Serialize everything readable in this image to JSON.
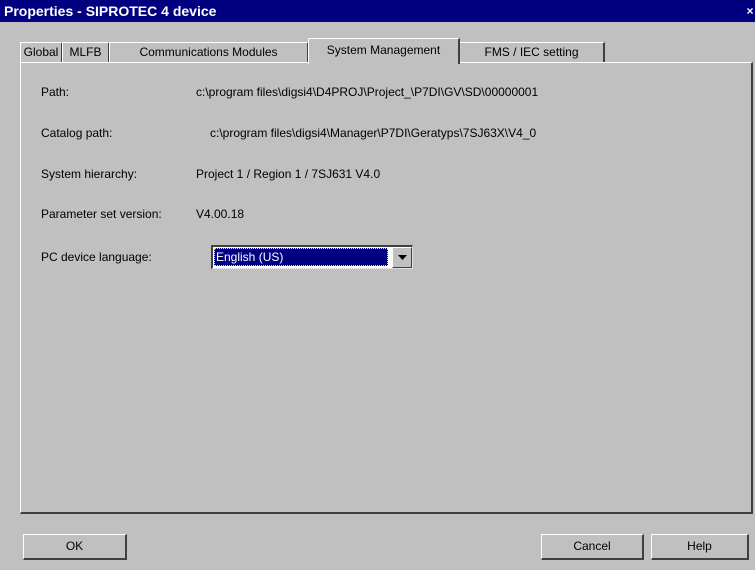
{
  "window": {
    "title": "Properties - SIPROTEC 4 device",
    "close_glyph": "×"
  },
  "tabs": [
    {
      "label": "Global"
    },
    {
      "label": "MLFB"
    },
    {
      "label": "Communications Modules"
    },
    {
      "label": "System Management",
      "active": true
    },
    {
      "label": "FMS / IEC setting"
    }
  ],
  "fields": {
    "path": {
      "label": "Path:",
      "value": "c:\\program files\\digsi4\\D4PROJ\\Project_\\P7DI\\GV\\SD\\00000001"
    },
    "catalog_path": {
      "label": "Catalog path:",
      "value": "c:\\program files\\digsi4\\Manager\\P7DI\\Geratyps\\7SJ63X\\V4_0"
    },
    "system_hierarchy": {
      "label": "System hierarchy:",
      "value": "Project 1 / Region 1 / 7SJ631 V4.0"
    },
    "parameter_set_version": {
      "label": "Parameter set version:",
      "value": "V4.00.18"
    },
    "pc_device_language": {
      "label": "PC device language:",
      "value": "English (US)"
    }
  },
  "buttons": {
    "ok": "OK",
    "cancel": "Cancel",
    "help": "Help"
  },
  "icons": {
    "dropdown": "chevron-down-icon",
    "close": "close-icon"
  }
}
